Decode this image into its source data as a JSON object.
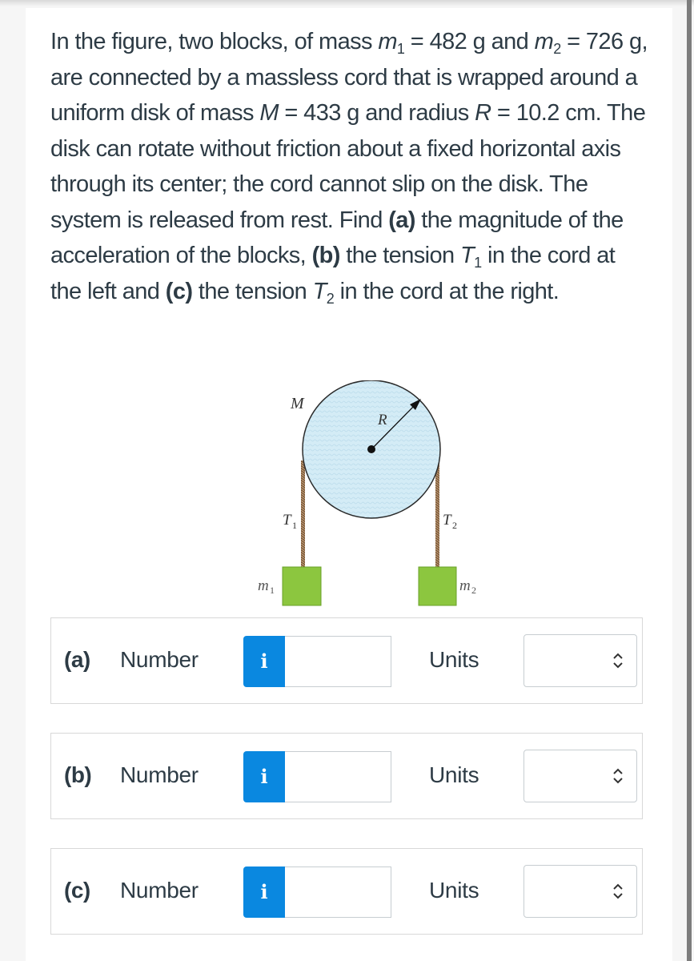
{
  "question": {
    "segments": {
      "s1": "In the figure, two blocks, of mass ",
      "m": "m",
      "sub1": "1",
      "s2": " = 482 g and ",
      "sub2": "2",
      "s3": " = 726 g, are connected by a massless cord that is wrapped around a uniform disk of mass ",
      "M": "M",
      "s4": " = 433 g and radius ",
      "R": "R",
      "s5": " = 10.2 cm. The disk can rotate without friction about a fixed horizontal axis through its center; the cord cannot slip on the disk. The system is released from rest. Find ",
      "a": "(a)",
      "s6": " the magnitude of the acceleration of the blocks, ",
      "b": "(b)",
      "s7": " the tension ",
      "T": "T",
      "s8": " in the cord at the left and ",
      "c": "(c)",
      "s9": " the tension ",
      "s10": " in the cord at the right."
    },
    "values": {
      "m1": "482 g",
      "m2": "726 g",
      "M": "433 g",
      "R": "10.2 cm"
    }
  },
  "figure": {
    "labels": {
      "disk_mass": "M",
      "radius": "R",
      "tension_left": "T",
      "tension_left_sub": "1",
      "tension_right": "T",
      "tension_right_sub": "2",
      "block_left": "m",
      "block_left_sub": "1",
      "block_right": "m",
      "block_right_sub": "2"
    },
    "colors": {
      "disk_fill": "#d4ecf6",
      "block_fill": "#8cc63f",
      "cord": "#8b6a4a"
    }
  },
  "answers": [
    {
      "part": "(a)",
      "number_label": "Number",
      "info_icon": "i",
      "number_value": "",
      "units_label": "Units",
      "units_value": ""
    },
    {
      "part": "(b)",
      "number_label": "Number",
      "info_icon": "i",
      "number_value": "",
      "units_label": "Units",
      "units_value": ""
    },
    {
      "part": "(c)",
      "number_label": "Number",
      "info_icon": "i",
      "number_value": "",
      "units_label": "Units",
      "units_value": ""
    }
  ],
  "colors": {
    "info_button": "#0a88e0",
    "text": "#2d3b45"
  }
}
